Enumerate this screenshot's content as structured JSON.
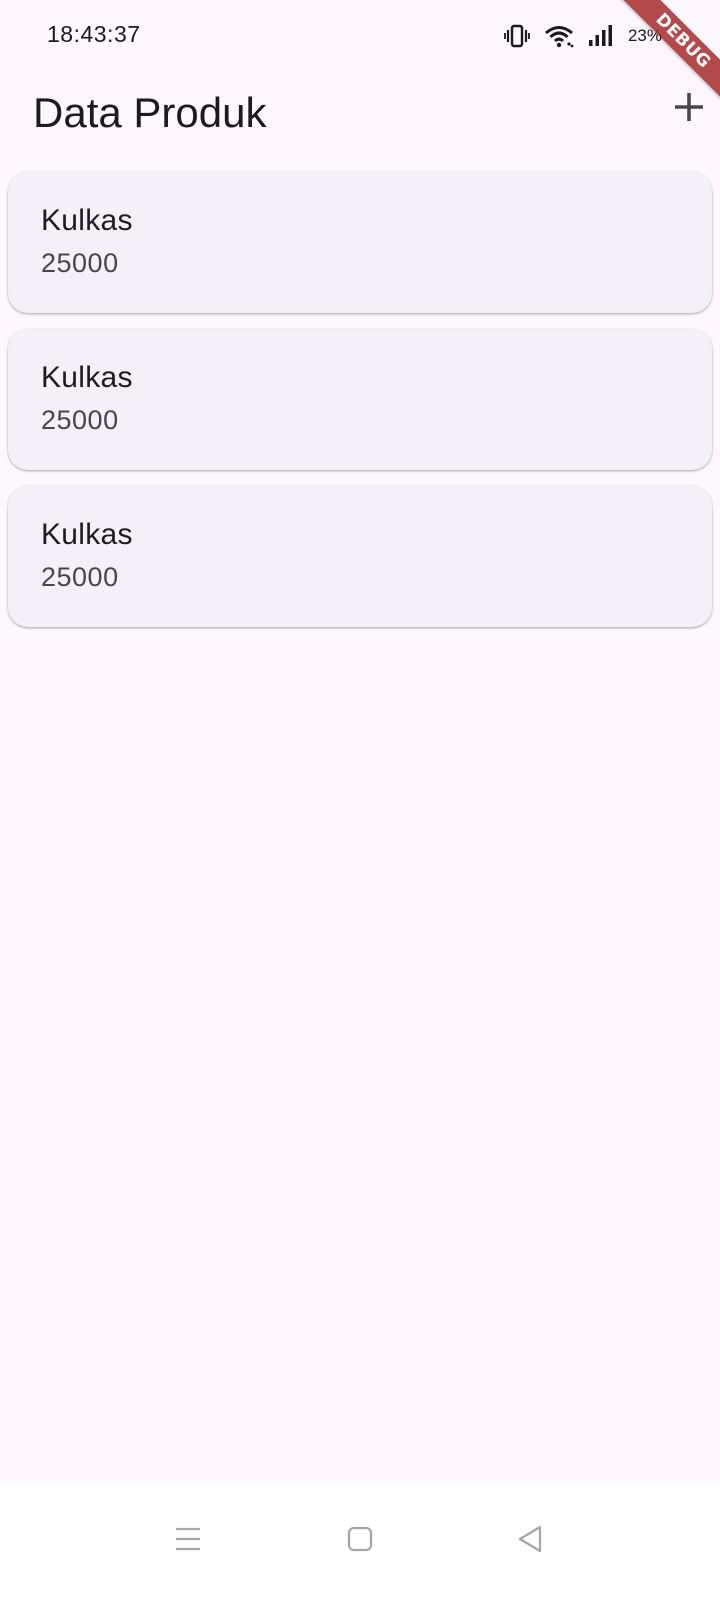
{
  "status_bar": {
    "time": "18:43:37",
    "battery": "23%",
    "icons": [
      "vibrate-icon",
      "wifi-icon",
      "signal-icon"
    ]
  },
  "debug_banner": {
    "label": "DEBUG",
    "color": "#a01e1e"
  },
  "app_bar": {
    "title": "Data Produk",
    "action_icon": "add-icon"
  },
  "products": [
    {
      "name": "Kulkas",
      "price": "25000"
    },
    {
      "name": "Kulkas",
      "price": "25000"
    },
    {
      "name": "Kulkas",
      "price": "25000"
    }
  ],
  "nav_bar": {
    "icons": [
      "menu-icon",
      "home-icon",
      "back-icon"
    ]
  },
  "colors": {
    "background": "#fef7fd",
    "card": "#f4f0f7",
    "title_text": "#1d1b20",
    "secondary_text": "#49454f"
  }
}
